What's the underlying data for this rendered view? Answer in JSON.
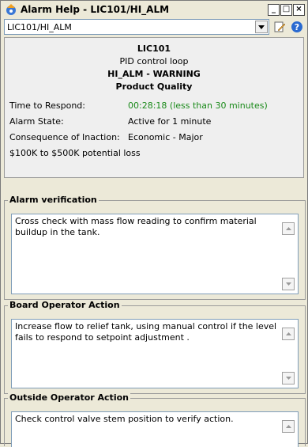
{
  "window": {
    "title": "Alarm Help - LIC101/HI_ALM"
  },
  "titlebar_buttons": {
    "minimize": "_",
    "maximize": "□",
    "close": "×"
  },
  "combo": {
    "value": "LIC101/HI_ALM"
  },
  "info": {
    "tag": "LIC101",
    "description": "PID control loop",
    "alarm": "HI_ALM - WARNING",
    "category": "Product Quality",
    "rows": [
      {
        "label": "Time to Respond:",
        "value": "00:28:18 (less than 30 minutes)"
      },
      {
        "label": "Alarm State:",
        "value": "Active for 1 minute"
      },
      {
        "label": "Consequence of Inaction:",
        "value": "Economic - Major"
      }
    ],
    "loss": "$100K to $500K potential loss"
  },
  "sections": [
    {
      "title": "Alarm verification",
      "text": "Cross check with mass flow reading to confirm material buildup in the tank."
    },
    {
      "title": "Board Operator Action",
      "text": "Increase flow to relief tank, using manual control if the level fails to respond to setpoint adjustment ."
    },
    {
      "title": "Outside Operator Action",
      "text": "Check control valve stem position to verify action."
    }
  ],
  "colors": {
    "accent_green": "#1a8a1a",
    "background": "#ece9d8"
  }
}
